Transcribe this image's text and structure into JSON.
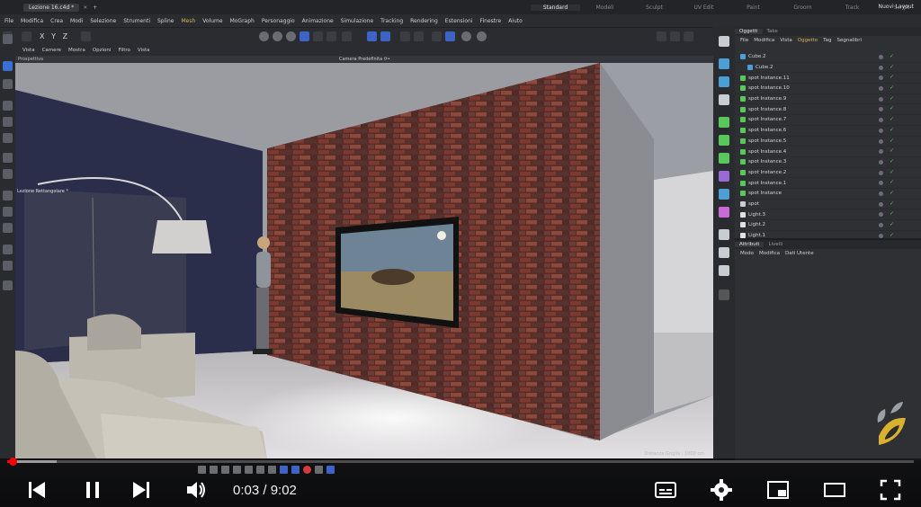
{
  "app": {
    "document_tab": "Lezione 16.c4d *",
    "layouts": [
      "Standard",
      "Modeli",
      "Sculpt",
      "UV Edit",
      "Paint",
      "Groom",
      "Track",
      "Script",
      "Nodes"
    ],
    "active_layout": "Standard",
    "layout_menu": "Nuovi Layout"
  },
  "menu": [
    "File",
    "Modifica",
    "Crea",
    "Modi",
    "Selezione",
    "Strumenti",
    "Spline",
    "Mesh",
    "Volume",
    "MoGraph",
    "Personaggio",
    "Animazione",
    "Simulazione",
    "Tracking",
    "Rendering",
    "Estensioni",
    "Finestre",
    "Aiuto"
  ],
  "menu_highlight": "Mesh",
  "toolbar": {
    "axes_x": "X",
    "axes_y": "Y",
    "axes_z": "Z"
  },
  "viewport": {
    "menu": [
      "Vista",
      "Camere",
      "Mostra",
      "Opzioni",
      "Filtro",
      "Vista"
    ],
    "panel_label": "Prospettiva",
    "camera_label": "Camera Predefinita ⟳•",
    "guide_label": "Lezione Rettangolare *",
    "safe_label": "Distanza Griglia : 1000 cm"
  },
  "objects_panel": {
    "tabs": [
      "Oggetti",
      "Take"
    ],
    "menu": [
      "File",
      "Modifica",
      "Vista",
      "Oggetto",
      "Tag",
      "Segnalibri"
    ],
    "menu_highlight": "Oggetto",
    "items": [
      {
        "name": "Cube.2",
        "icon": "cube-icon"
      },
      {
        "name": "Cube.2",
        "icon": "cube-icon"
      },
      {
        "name": "spot Instance.11",
        "icon": "instance-icon"
      },
      {
        "name": "spot Instance.10",
        "icon": "instance-icon"
      },
      {
        "name": "spot Instance.9",
        "icon": "instance-icon"
      },
      {
        "name": "spot Instance.8",
        "icon": "instance-icon"
      },
      {
        "name": "spot Instance.7",
        "icon": "instance-icon"
      },
      {
        "name": "spot Instance.6",
        "icon": "instance-icon"
      },
      {
        "name": "spot Instance.5",
        "icon": "instance-icon"
      },
      {
        "name": "spot Instance.4",
        "icon": "instance-icon"
      },
      {
        "name": "spot Instance.3",
        "icon": "instance-icon"
      },
      {
        "name": "spot Instance.2",
        "icon": "instance-icon"
      },
      {
        "name": "spot Instance.1",
        "icon": "instance-icon"
      },
      {
        "name": "spot Instance",
        "icon": "instance-icon"
      },
      {
        "name": "spot",
        "icon": "spot-light-icon"
      },
      {
        "name": "Light.3",
        "icon": "light-icon"
      },
      {
        "name": "Light.2",
        "icon": "light-icon"
      },
      {
        "name": "Light.1",
        "icon": "light-icon"
      }
    ]
  },
  "attributes_panel": {
    "tabs": [
      "Attributi",
      "Livelli"
    ],
    "menu": [
      "Modo",
      "Modifica",
      "Dati Utente"
    ]
  },
  "player": {
    "time": "0:03 / 9:02",
    "progress_fraction": 0.0055,
    "buffered_fraction": 0.055
  },
  "colors": {
    "accent_blue": "#3d63c7",
    "highlight_gold": "#d8b25a",
    "progress_red": "#ff0000",
    "check_green": "#58c85a"
  }
}
